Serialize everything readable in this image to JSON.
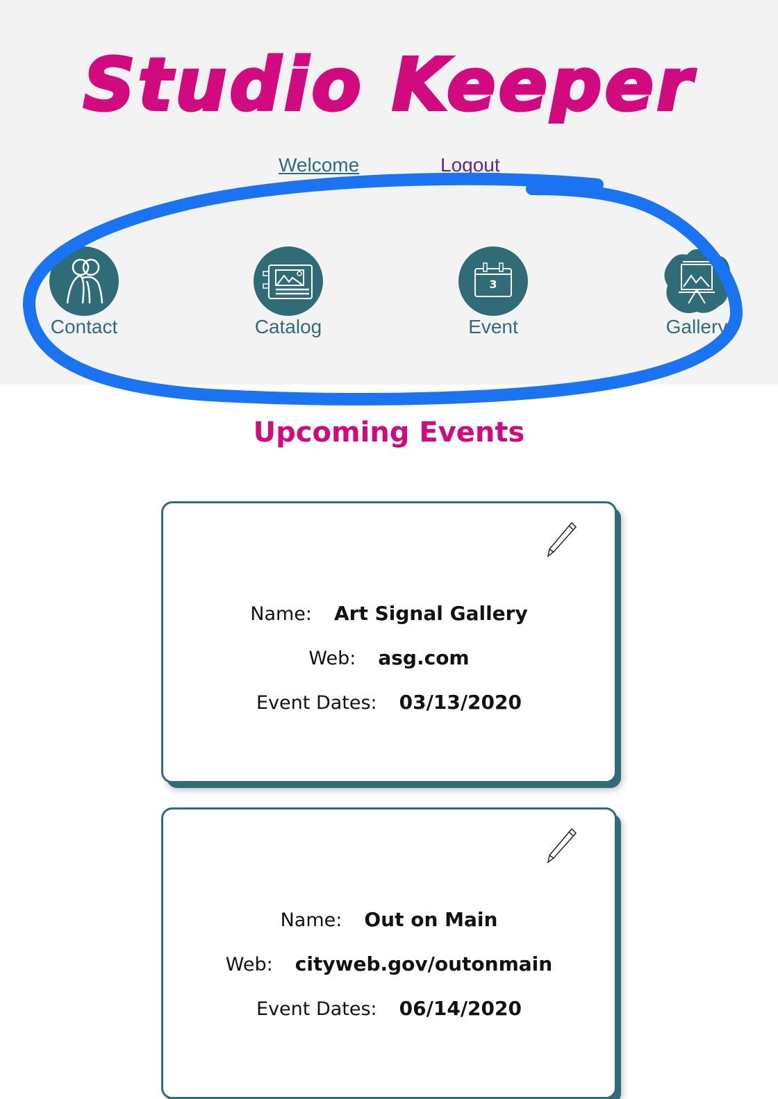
{
  "header": {
    "logo_text": "Studio Keeper",
    "welcome_link": "Welcome",
    "logout_link": "Logout",
    "brand_color": "#d10a7f",
    "accent_color": "#2f6c78"
  },
  "nav": {
    "items": [
      {
        "label": "Contact",
        "icon": "people-icon"
      },
      {
        "label": "Catalog",
        "icon": "catalog-image-icon"
      },
      {
        "label": "Event",
        "icon": "calendar-icon",
        "calendar_day": "3"
      },
      {
        "label": "Gallery",
        "icon": "easel-icon"
      }
    ]
  },
  "main": {
    "title": "Upcoming Events",
    "events": [
      {
        "name_label": "Name:",
        "name": "Art Signal Gallery",
        "web_label": "Web:",
        "web": "asg.com",
        "dates_label": "Event Dates:",
        "dates": "03/13/2020"
      },
      {
        "name_label": "Name:",
        "name": "Out on Main",
        "web_label": "Web:",
        "web": "cityweb.gov/outonmain",
        "dates_label": "Event Dates:",
        "dates": "06/14/2020"
      }
    ]
  }
}
